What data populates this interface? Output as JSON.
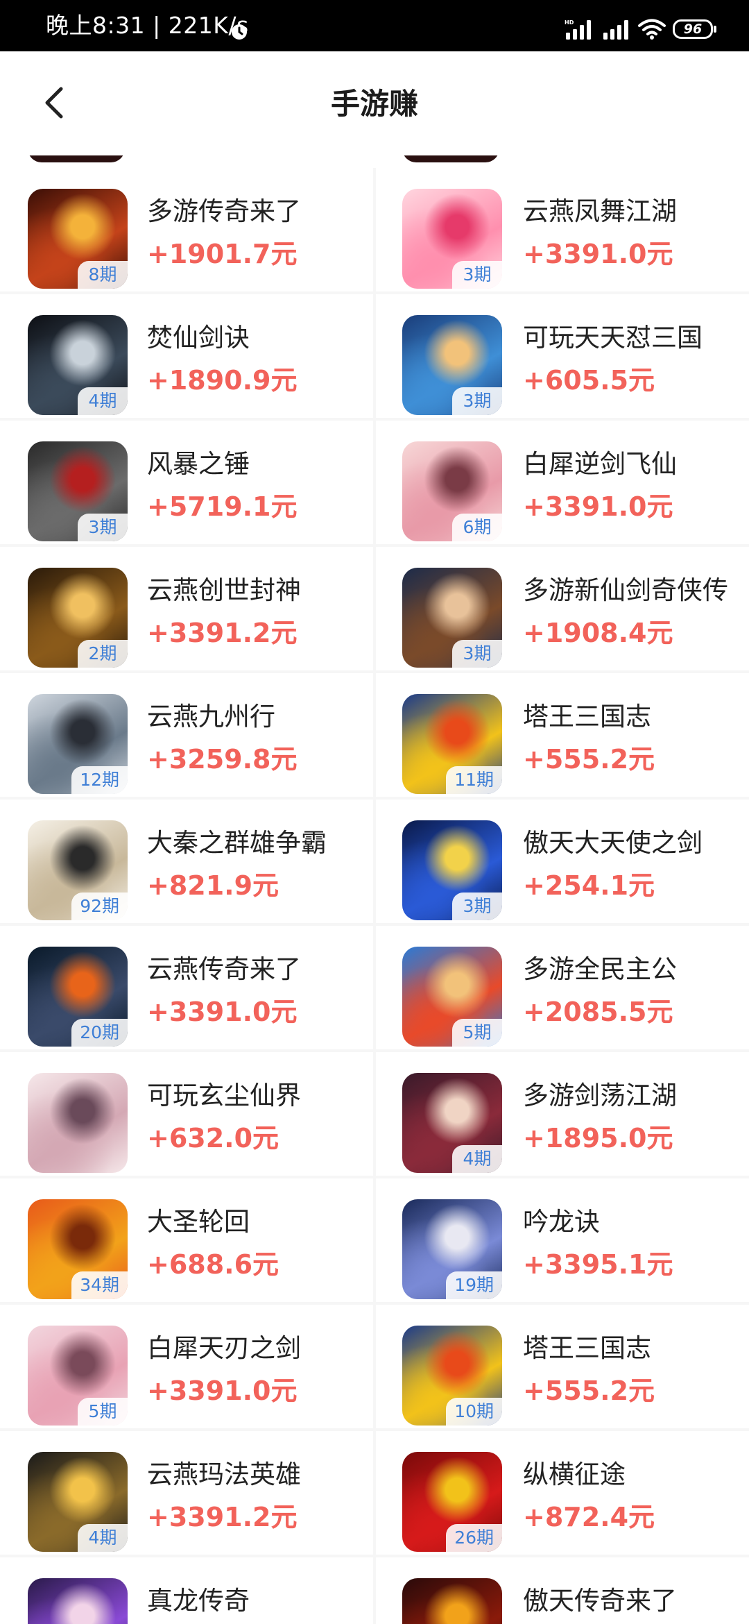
{
  "status_bar": {
    "time": "晚上8:31 | 221K/s",
    "battery": "96",
    "network_badge": "HD"
  },
  "header": {
    "title": "手游赚"
  },
  "colors": {
    "reward": "#f2625a",
    "badge_text": "#3f7fd6",
    "background": "#f6f6f6"
  },
  "games": [
    [
      {
        "name": "多游传奇来了",
        "reward": "+1901.7元",
        "period": "8期",
        "icon": "legend-game-icon",
        "art": [
          "#3a0e06",
          "#c4431a",
          "#f4b23a"
        ]
      },
      {
        "name": "云燕凤舞江湖",
        "reward": "+3391.0元",
        "period": "3期",
        "icon": "phoenix-game-icon",
        "art": [
          "#ffd6df",
          "#ff8fae",
          "#e63a6a"
        ]
      }
    ],
    [
      {
        "name": "焚仙剑诀",
        "reward": "+1890.9元",
        "period": "4期",
        "icon": "sword-game-icon",
        "art": [
          "#0d0f14",
          "#3b4a5a",
          "#c9d2da"
        ]
      },
      {
        "name": "可玩天天怼三国",
        "reward": "+605.5元",
        "period": "3期",
        "icon": "three-kingdoms-game-icon",
        "art": [
          "#1a3d7a",
          "#3f8fd6",
          "#f2c27a"
        ]
      }
    ],
    [
      {
        "name": "风暴之锤",
        "reward": "+5719.1元",
        "period": "3期",
        "icon": "dragon-game-icon",
        "art": [
          "#2a2a2a",
          "#6b6b6b",
          "#b51f1f"
        ]
      },
      {
        "name": "白犀逆剑飞仙",
        "reward": "+3391.0元",
        "period": "6期",
        "icon": "immortal-game-icon",
        "art": [
          "#f7d7d7",
          "#e89aa8",
          "#7a3b46"
        ]
      }
    ],
    [
      {
        "name": "云燕创世封神",
        "reward": "+3391.2元",
        "period": "2期",
        "icon": "deity-game-icon",
        "art": [
          "#2a1a0a",
          "#8a5a1a",
          "#f0c060"
        ]
      },
      {
        "name": "多游新仙剑奇侠传",
        "reward": "+1908.4元",
        "period": "3期",
        "icon": "chivalry-game-icon",
        "art": [
          "#1c2b4a",
          "#7a4a2a",
          "#e8c29a"
        ]
      }
    ],
    [
      {
        "name": "云燕九州行",
        "reward": "+3259.8元",
        "period": "12期",
        "icon": "warrior-game-icon",
        "art": [
          "#cfd6de",
          "#6a7a8a",
          "#2a2e36"
        ]
      },
      {
        "name": "塔王三国志",
        "reward": "+555.2元",
        "period": "11期",
        "icon": "tower-king-game-icon",
        "art": [
          "#1a3a8a",
          "#f2c21a",
          "#e84a1a"
        ]
      }
    ],
    [
      {
        "name": "大秦之群雄争霸",
        "reward": "+821.9元",
        "period": "92期",
        "icon": "qin-game-icon",
        "art": [
          "#f5f0e6",
          "#c8b89a",
          "#2a2a2a"
        ]
      },
      {
        "name": "傲天大天使之剑",
        "reward": "+254.1元",
        "period": "3期",
        "icon": "angel-sword-game-icon",
        "art": [
          "#0a1a4a",
          "#2a5ad6",
          "#f2d24a"
        ]
      }
    ],
    [
      {
        "name": "云燕传奇来了",
        "reward": "+3391.0元",
        "period": "20期",
        "icon": "flame-sword-game-icon",
        "art": [
          "#0a1a2a",
          "#3a4a6a",
          "#e8641a"
        ]
      },
      {
        "name": "多游全民主公",
        "reward": "+2085.5元",
        "period": "5期",
        "icon": "lord-game-icon",
        "art": [
          "#2a7ad6",
          "#e84a2a",
          "#f2c27a"
        ]
      }
    ],
    [
      {
        "name": "可玩玄尘仙界",
        "reward": "+632.0元",
        "period": "",
        "icon": "fairy-game-icon",
        "art": [
          "#f6e8ea",
          "#d4a8b4",
          "#6a4a5a"
        ]
      },
      {
        "name": "多游剑荡江湖",
        "reward": "+1895.0元",
        "period": "4期",
        "icon": "swordswoman-game-icon",
        "art": [
          "#3a1a2a",
          "#8a2a3a",
          "#f0d4c4"
        ]
      }
    ],
    [
      {
        "name": "大圣轮回",
        "reward": "+688.6元",
        "period": "34期",
        "icon": "monkey-king-game-icon",
        "art": [
          "#e85a1a",
          "#f2a21a",
          "#7a2a0a"
        ]
      },
      {
        "name": "吟龙诀",
        "reward": "+3395.1元",
        "period": "19期",
        "icon": "dragon-chant-game-icon",
        "art": [
          "#1a2a5a",
          "#7a8ad6",
          "#e8e8f2"
        ]
      }
    ],
    [
      {
        "name": "白犀天刃之剑",
        "reward": "+3391.0元",
        "period": "5期",
        "icon": "blade-game-icon",
        "art": [
          "#f2d6de",
          "#e8a2b4",
          "#7a4a5a"
        ]
      },
      {
        "name": "塔王三国志",
        "reward": "+555.2元",
        "period": "10期",
        "icon": "tower-king-game-icon",
        "art": [
          "#1a3a8a",
          "#f2c21a",
          "#e84a1a"
        ]
      }
    ],
    [
      {
        "name": "云燕玛法英雄",
        "reward": "+3391.2元",
        "period": "4期",
        "icon": "mafa-hero-game-icon",
        "art": [
          "#1a1a1a",
          "#8a6a2a",
          "#f2c24a"
        ]
      },
      {
        "name": "纵横征途",
        "reward": "+872.4元",
        "period": "26期",
        "icon": "journey-game-icon",
        "art": [
          "#7a0a0a",
          "#d61a1a",
          "#f2c21a"
        ]
      }
    ],
    [
      {
        "name": "真龙传奇",
        "reward": "",
        "period": "",
        "icon": "true-dragon-game-icon",
        "art": [
          "#2a1a4a",
          "#8a4ad6",
          "#f2d4e8"
        ]
      },
      {
        "name": "傲天传奇来了",
        "reward": "",
        "period": "",
        "icon": "legend-come-game-icon",
        "art": [
          "#2a0a0a",
          "#8a1a0a",
          "#f2a21a"
        ]
      }
    ]
  ]
}
